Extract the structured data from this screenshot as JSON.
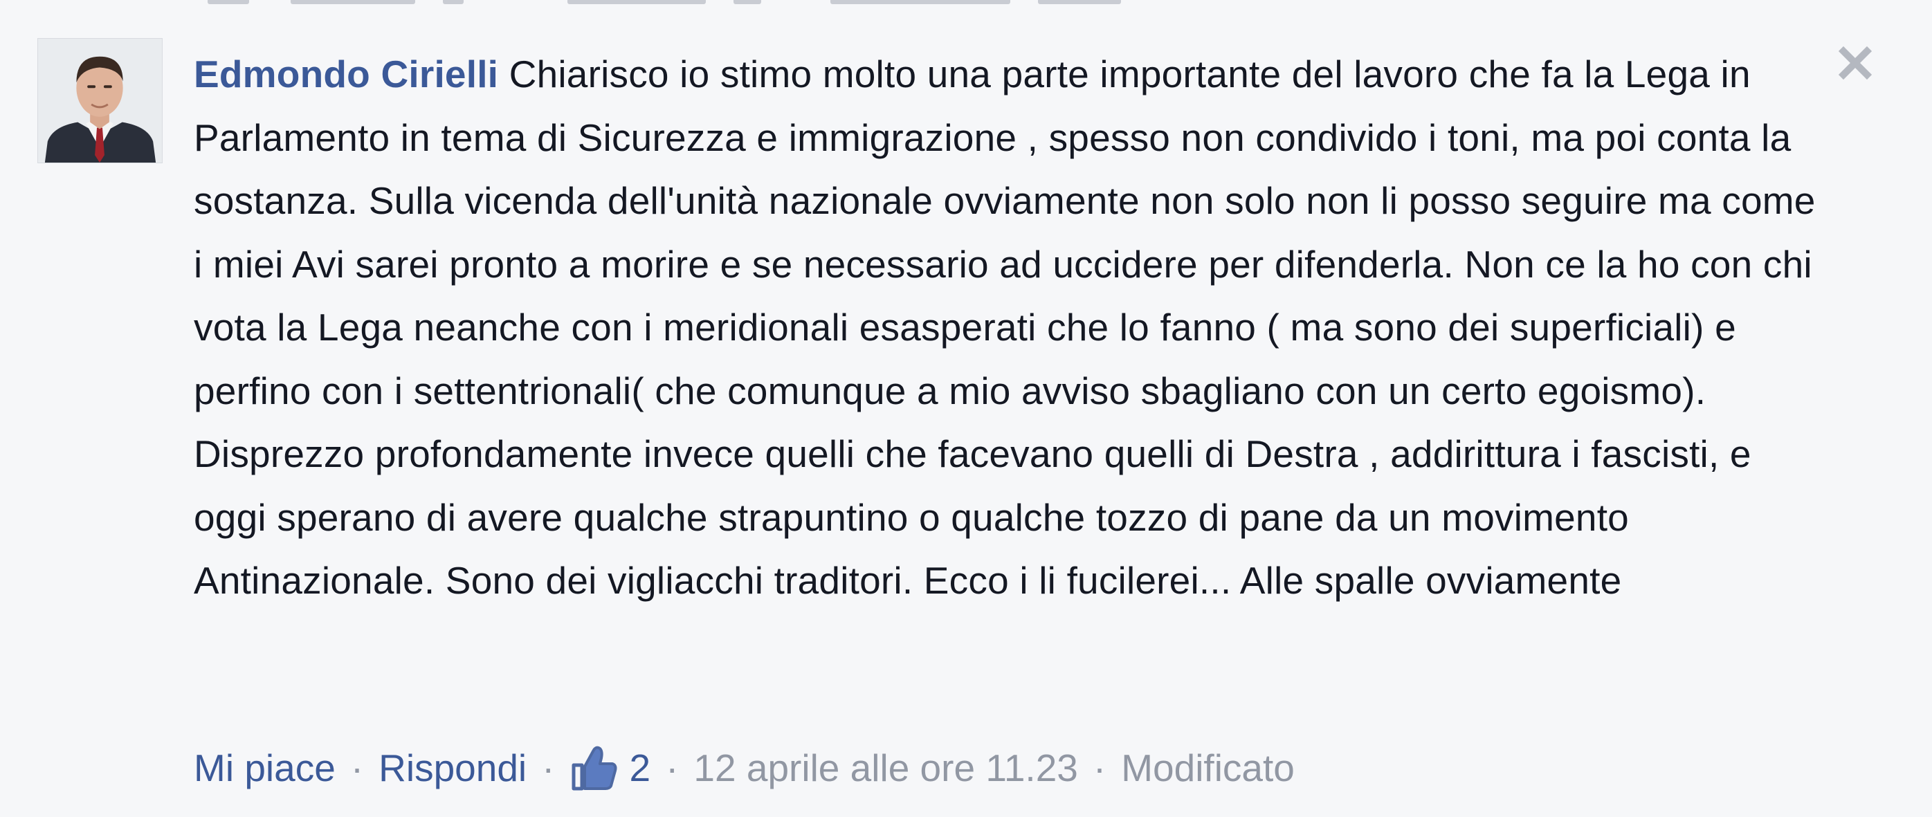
{
  "comment": {
    "author": "Edmondo Cirielli",
    "text": "Chiarisco io stimo molto una parte importante del lavoro che fa la Lega in Parlamento in tema di Sicurezza e immigrazione , spesso non condivido i toni, ma poi conta la sostanza. Sulla vicenda dell'unità nazionale ovviamente non solo non li posso seguire ma come i miei Avi sarei pronto a morire e se necessario ad uccidere per difenderla. Non ce la ho con chi vota la Lega neanche con i meridionali esasperati che lo fanno ( ma sono dei superficiali) e perfino con i settentrionali( che comunque a mio avviso sbagliano con un certo egoismo). Disprezzo profondamente invece quelli che facevano quelli di Destra , addirittura i fascisti, e oggi sperano di avere qualche strapuntino o qualche tozzo di pane da un movimento Antinazionale. Sono dei vigliacchi traditori. Ecco i li fucilerei... Alle spalle ovviamente",
    "actions": {
      "like_label": "Mi piace",
      "reply_label": "Rispondi",
      "separator": "·",
      "like_count": "2",
      "timestamp": "12 aprile alle ore 11.23",
      "edited_label": "Modificato"
    },
    "icons": {
      "like": "thumbs-up-icon",
      "close": "close-icon",
      "avatar": "profile-photo"
    },
    "colors": {
      "author": "#3b5998",
      "link": "#3b5998",
      "meta": "#9197a3",
      "text": "#141823",
      "background": "#f6f7f9"
    }
  }
}
